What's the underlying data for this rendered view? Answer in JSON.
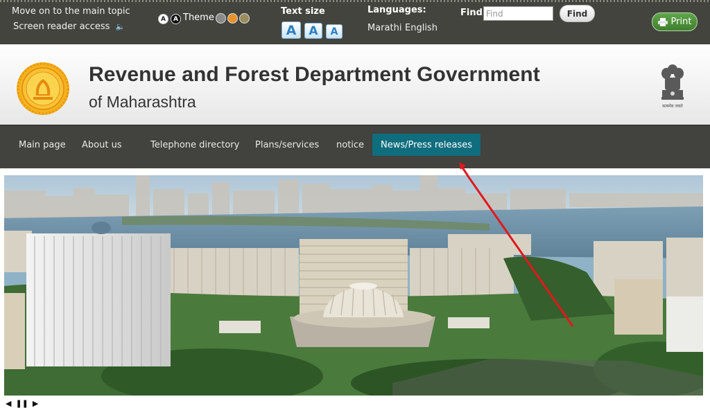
{
  "topbar": {
    "skip_link": "Move on to the main topic",
    "screen_reader": "Screen reader access",
    "contrast_light": "A",
    "contrast_dark": "A",
    "theme_label": "Theme",
    "theme_colors": [
      "#8a8a88",
      "#e8922a",
      "#9a8c5c"
    ],
    "text_size_label": "Text size",
    "text_size_buttons": [
      "A",
      "A",
      "A"
    ],
    "languages_label": "Languages:",
    "languages": [
      "Marathi",
      "English"
    ],
    "find_label": "Find",
    "find_placeholder": "Find",
    "find_button": "Find",
    "print_button": "Print"
  },
  "header": {
    "title": "Revenue and Forest Department Government",
    "subtitle": "of Maharashtra",
    "emblem_motto": "सत्यमेव जयते"
  },
  "nav": {
    "items": [
      "Main page",
      "About us",
      "Telephone directory",
      "Plans/services",
      "notice",
      "News/Press releases"
    ],
    "active_index": 5,
    "active_color": "#0f6d7d"
  },
  "annotation": {
    "color": "#e0181c"
  },
  "slider": {
    "prev": "◀",
    "pause": "❚❚",
    "next": "▶"
  }
}
